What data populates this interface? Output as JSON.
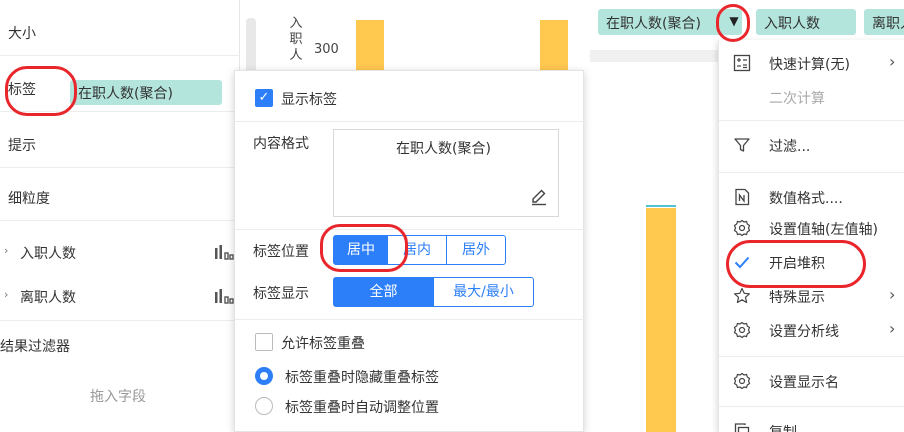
{
  "left_panel": {
    "size_label": "大小",
    "label_label": "标签",
    "label_pill": "在职人数(聚合)",
    "tip_label": "提示",
    "detail_label": "细粒度",
    "fields": [
      {
        "name": "入职人数",
        "arrow": "›"
      },
      {
        "name": "离职人数",
        "arrow": "›"
      }
    ],
    "result_filter": "结果过滤器",
    "drag_hint": "拖入字段"
  },
  "chart": {
    "y_title": "入职人",
    "y_tick": "300",
    "bar_color": "#ffc84f"
  },
  "shelf": {
    "pills": [
      "在职人数(聚合)",
      "入职人数",
      "离职人数"
    ],
    "dropdown_glyph": "▼"
  },
  "label_popup": {
    "show_label": "显示标签",
    "content_format_label": "内容格式",
    "content_format_value": "在职人数(聚合)",
    "label_position_label": "标签位置",
    "positions": [
      "居中",
      "居内",
      "居外"
    ],
    "selected_position": "居中",
    "label_display_label": "标签显示",
    "display_options": [
      "全部",
      "最大/最小"
    ],
    "selected_display": "全部",
    "allow_overlap": "允许标签重叠",
    "overlap_hide": "标签重叠时隐藏重叠标签",
    "overlap_adjust": "标签重叠时自动调整位置"
  },
  "context_menu": {
    "items": [
      {
        "label": "快速计算(无)",
        "icon": "calc-icon",
        "chevron": "›"
      },
      {
        "label": "二次计算",
        "disabled": true
      },
      {
        "label": "过滤...",
        "icon": "filter-icon"
      },
      {
        "label": "数值格式....",
        "icon": "number-format-icon"
      },
      {
        "label": "设置值轴(左值轴)",
        "icon": "gear-icon"
      },
      {
        "label": "开启堆积",
        "icon": "check-icon"
      },
      {
        "label": "特殊显示",
        "icon": "star-icon",
        "chevron": "›"
      },
      {
        "label": "设置分析线",
        "icon": "gear-icon",
        "chevron": "›"
      },
      {
        "label": "设置显示名",
        "icon": "gear-icon"
      },
      {
        "label": "复制",
        "icon": "copy-icon"
      }
    ]
  },
  "colors": {
    "accent": "#2d7ff9",
    "teal_pill": "#b3e5dc",
    "highlight": "#e8262b"
  }
}
